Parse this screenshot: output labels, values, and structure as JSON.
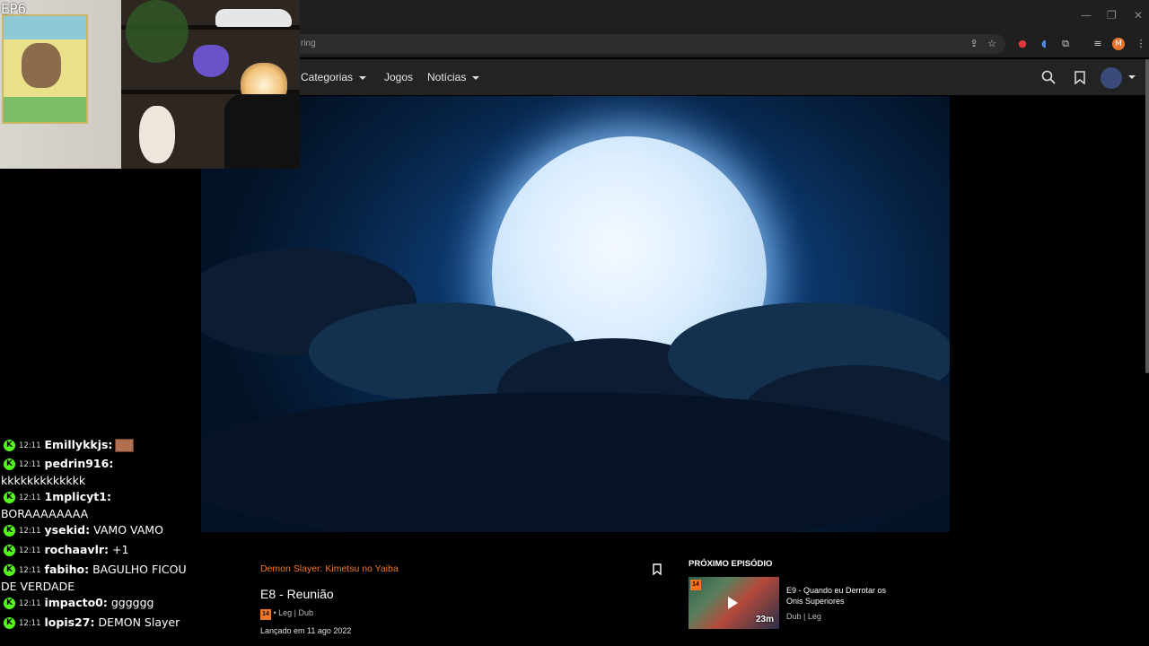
{
  "browser": {
    "address_partial": "ring",
    "window_controls": [
      "—",
      "❐",
      "✕"
    ],
    "toolbar_icons": [
      "install-icon",
      "star-icon",
      "extension-red-icon",
      "extension-blue-icon",
      "puzzle-icon",
      "media-icon",
      "profile-icon",
      "menu-icon"
    ],
    "profile_initial": "M"
  },
  "nav": {
    "categories": "Categorias",
    "games": "Jogos",
    "news": "Notícias"
  },
  "webcam": {
    "overlay_label": "EP6"
  },
  "chat": {
    "messages": [
      {
        "time": "12:11",
        "user": "Emillykkjs:",
        "text": "",
        "emote": true
      },
      {
        "time": "12:11",
        "user": "pedrin916:",
        "text": "kkkkkkkkkkkkk"
      },
      {
        "time": "12:11",
        "user": "1mplicyt1:",
        "text": "BORAAAAAAAA"
      },
      {
        "time": "12:11",
        "user": "ysekid:",
        "text": "VAMO VAMO"
      },
      {
        "time": "12:11",
        "user": "rochaavlr:",
        "text": "+1"
      },
      {
        "time": "12:11",
        "user": "fabiho:",
        "text": "BAGULHO FICOU DE VERDADE"
      },
      {
        "time": "12:11",
        "user": "impacto0:",
        "text": "gggggg"
      },
      {
        "time": "12:11",
        "user": "lopis27:",
        "text": "DEMON Slayer"
      }
    ],
    "badge_letter": "K"
  },
  "episode": {
    "series": "Demon Slayer: Kimetsu no Yaiba",
    "title": "E8 - Reunião",
    "rating": "14",
    "audio": "• Leg | Dub",
    "release": "Lançado em 11 ago 2022"
  },
  "next_episode": {
    "header": "PRÓXIMO EPISÓDIO",
    "rating": "14",
    "duration": "23m",
    "title": "E9 - Quando eu Derrotar os Onis Superiores",
    "audio": "Dub | Leg"
  },
  "colors": {
    "accent": "#f47521",
    "kick_green": "#53fc18"
  }
}
